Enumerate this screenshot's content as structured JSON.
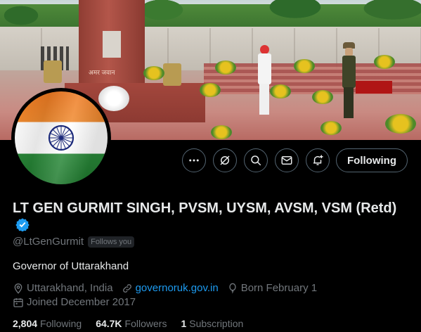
{
  "banner": {
    "memorial_inscription": "अमर जवान"
  },
  "profile": {
    "name": "LT GEN GURMIT SINGH, PVSM, UYSM, AVSM, VSM (Retd)",
    "handle": "@LtGenGurmit",
    "follows_you": "Follows you",
    "bio": "Governor of Uttarakhand",
    "location": "Uttarakhand, India",
    "website": "governoruk.gov.in",
    "birthday": "Born February 1",
    "joined": "Joined December 2017"
  },
  "actions": {
    "more_icon": "more-icon",
    "grok_icon": "grok-icon",
    "search_icon": "search-icon",
    "message_icon": "message-icon",
    "notify_icon": "bell-add-icon",
    "following_label": "Following"
  },
  "stats": {
    "following_count": "2,804",
    "following_label": "Following",
    "followers_count": "64.7K",
    "followers_label": "Followers",
    "subscription_count": "1",
    "subscription_label": "Subscription"
  },
  "colors": {
    "background": "#000000",
    "text_primary": "#e7e9ea",
    "text_secondary": "#71767b",
    "link": "#1d9bf0",
    "button_border": "#536471",
    "verified_badge": "#1d9bf0"
  }
}
